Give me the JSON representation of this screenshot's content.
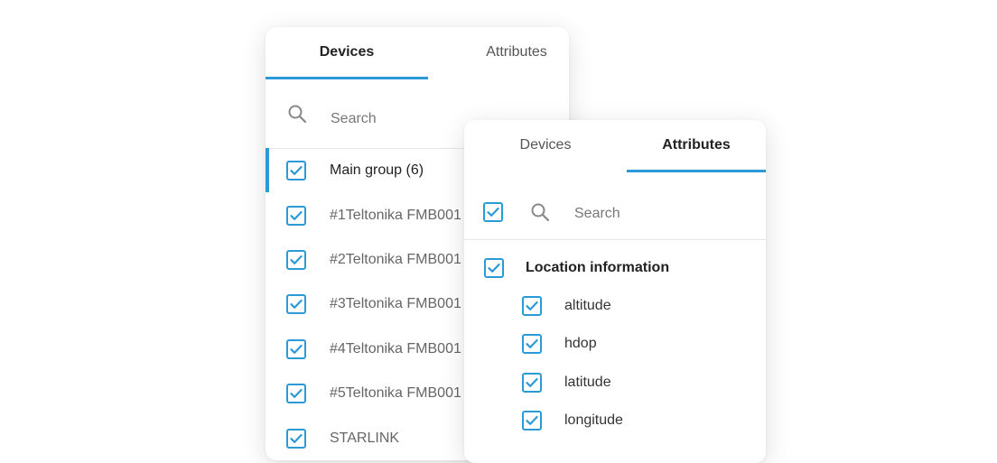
{
  "devices_panel": {
    "tabs": [
      {
        "label": "Devices",
        "active": true
      },
      {
        "label": "Attributes",
        "active": false
      }
    ],
    "search": {
      "placeholder": "Search",
      "value": ""
    },
    "group": {
      "label": "Main group (6)",
      "checked": true
    },
    "items": [
      {
        "label": "#1Teltonika FMB001",
        "checked": true
      },
      {
        "label": "#2Teltonika FMB001",
        "checked": true
      },
      {
        "label": "#3Teltonika FMB001",
        "checked": true
      },
      {
        "label": "#4Teltonika FMB001",
        "checked": true
      },
      {
        "label": "#5Teltonika FMB001",
        "checked": true
      },
      {
        "label": "STARLINK",
        "checked": true
      }
    ]
  },
  "attributes_panel": {
    "tabs": [
      {
        "label": "Devices",
        "active": false
      },
      {
        "label": "Attributes",
        "active": true
      }
    ],
    "search": {
      "placeholder": "Search",
      "value": ""
    },
    "select_all_checked": true,
    "group": {
      "label": "Location information",
      "checked": true
    },
    "items": [
      {
        "label": "altitude",
        "checked": true
      },
      {
        "label": "hdop",
        "checked": true
      },
      {
        "label": "latitude",
        "checked": true
      },
      {
        "label": "longitude",
        "checked": true
      }
    ]
  },
  "colors": {
    "accent": "#2d9ad8",
    "divider": "#e6e6e6"
  },
  "icons": {
    "search": "search-icon",
    "checkbox": "checkbox-checked-icon"
  }
}
